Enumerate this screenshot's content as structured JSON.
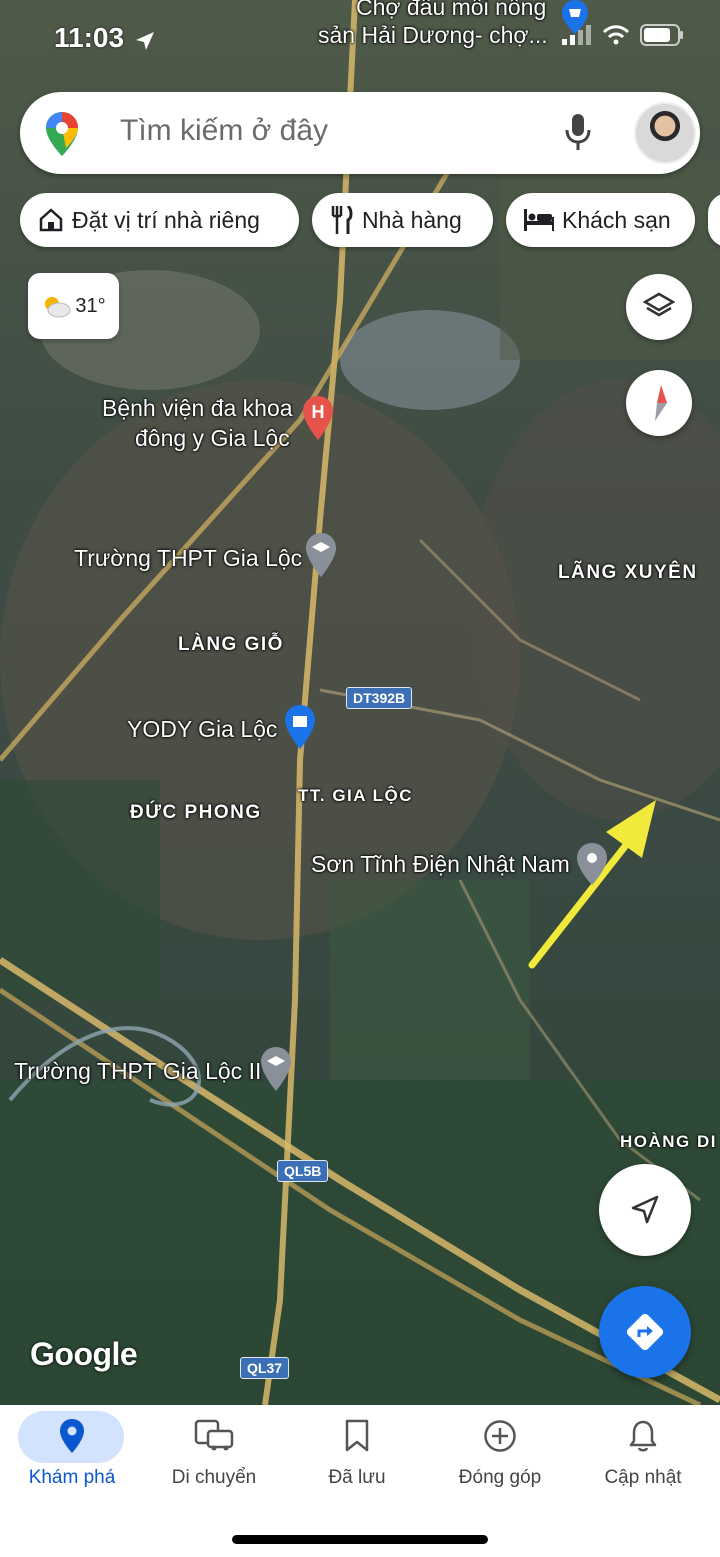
{
  "status_bar": {
    "time": "11:03"
  },
  "search": {
    "placeholder": "Tìm kiếm ở đây"
  },
  "chips": [
    {
      "label": "Đặt vị trí nhà riêng",
      "icon": "home-icon"
    },
    {
      "label": "Nhà hàng",
      "icon": "restaurant-icon"
    },
    {
      "label": "Khách sạn",
      "icon": "hotel-icon"
    }
  ],
  "weather": {
    "temp": "31°",
    "icon": "partly-cloudy-icon"
  },
  "map": {
    "poi_labels": {
      "top_poi_line1": "Chợ đầu mối nông",
      "top_poi_line2": "sản Hải Dương- chợ...",
      "hospital_line1": "Bệnh viện đa khoa",
      "hospital_line2": "đông y Gia Lộc",
      "school1": "Trường THPT Gia Lộc",
      "yody": "YODY Gia Lộc",
      "son_tinh_dien": "Sơn Tĩnh Điện Nhật Nam",
      "school2": "Trường THPT Gia Lộc II"
    },
    "area_labels": {
      "lang_xuyen": "LÃNG XUYÊN",
      "lang_gio": "LÀNG GIỖ",
      "duc_phong": "ĐỨC PHONG",
      "tt_gia_loc": "TT. GIA LỘC",
      "hoang_di": "HOÀNG DI"
    },
    "road_shields": {
      "dt392b": "DT392B",
      "ql5b": "QL5B",
      "ql37": "QL37"
    },
    "attribution": "Google",
    "annotation_arrow_color": "#f2ea3a"
  },
  "nav": {
    "items": [
      {
        "label": "Khám phá",
        "icon": "location-pin-icon",
        "active": true
      },
      {
        "label": "Di chuyển",
        "icon": "commute-icon",
        "active": false
      },
      {
        "label": "Đã lưu",
        "icon": "bookmark-icon",
        "active": false
      },
      {
        "label": "Đóng góp",
        "icon": "add-circle-icon",
        "active": false
      },
      {
        "label": "Cập nhật",
        "icon": "bell-icon",
        "active": false
      }
    ]
  },
  "colors": {
    "accent": "#1a73e8",
    "nav_active_bg": "#d3e3fd"
  }
}
